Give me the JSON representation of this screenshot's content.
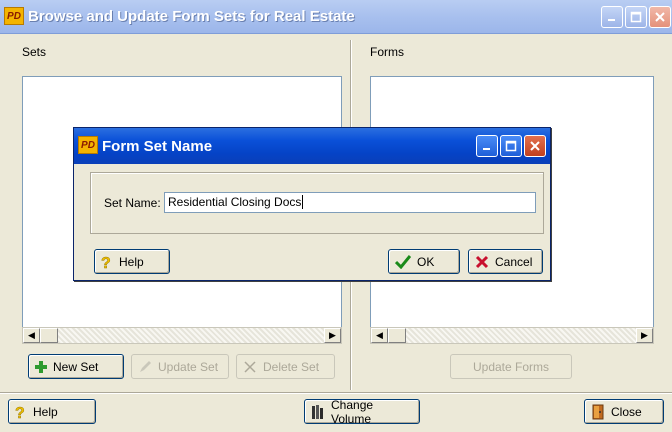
{
  "window": {
    "logo_text": "PD",
    "title": "Browse and Update Form Sets for Real Estate"
  },
  "sets_panel": {
    "label": "Sets",
    "new_set_label": "New Set",
    "update_set_label": "Update Set",
    "delete_set_label": "Delete Set"
  },
  "forms_panel": {
    "label": "Forms",
    "update_forms_label": "Update Forms"
  },
  "bottom_bar": {
    "help_label": "Help",
    "change_volume_label": "Change Volume",
    "close_label": "Close"
  },
  "dialog": {
    "logo_text": "PD",
    "title": "Form Set Name",
    "set_name_label": "Set Name:",
    "set_name_value": "Residential Closing Docs",
    "help_label": "Help",
    "ok_label": "OK",
    "cancel_label": "Cancel"
  },
  "colors": {
    "titlebar_inactive": "#a8c0ee",
    "titlebar_active": "#0a50d8",
    "face": "#ece9d8"
  }
}
